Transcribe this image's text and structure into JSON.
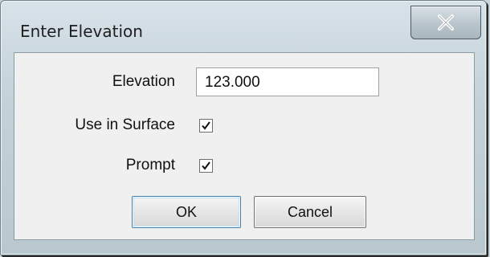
{
  "window": {
    "title": "Enter Elevation",
    "close_label": "X"
  },
  "form": {
    "elevation_label": "Elevation",
    "elevation_value": "123.000",
    "use_in_surface_label": "Use in Surface",
    "use_in_surface_checked": true,
    "prompt_label": "Prompt",
    "prompt_checked": true
  },
  "buttons": {
    "ok_label": "OK",
    "cancel_label": "Cancel"
  },
  "colors": {
    "title_bar": "#c9d4da",
    "client_bg": "#f0f0f0",
    "default_button_border": "#3c7fb1"
  }
}
